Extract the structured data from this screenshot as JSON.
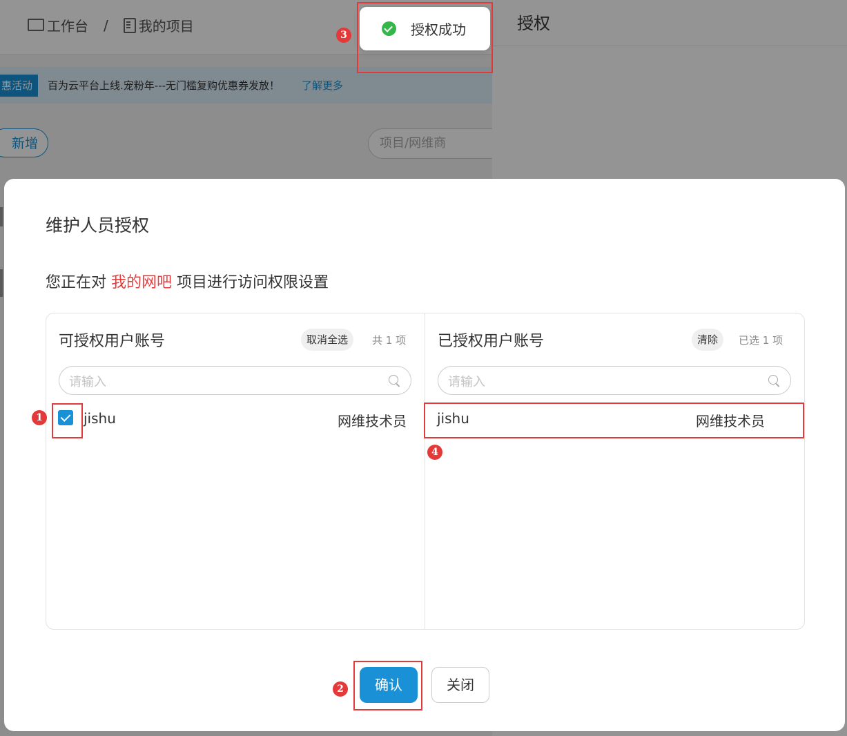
{
  "background": {
    "breadcrumb": {
      "workbench": "工作台",
      "separator": "/",
      "my_projects": "我的项目"
    },
    "notice": {
      "tag": "惠活动",
      "text": "百为云平台上线.宠粉年---无门槛复购优惠券发放！",
      "link": "了解更多"
    },
    "new_button": "新增",
    "search_placeholder": "项目/网维商",
    "drawer_title": "授权"
  },
  "toast": {
    "text": "授权成功",
    "icon": "check-circle-icon",
    "color": "#35b64a"
  },
  "dialog": {
    "title": "维护人员授权",
    "subtitle_prefix": "您正在对",
    "project_name": "我的网吧",
    "subtitle_suffix": "项目进行访问权限设置",
    "left_panel": {
      "title": "可授权用户账号",
      "action": "取消全选",
      "count": "共 1 项",
      "search_placeholder": "请输入",
      "items": [
        {
          "name": "jishu",
          "role": "网维技术员",
          "checked": true
        }
      ]
    },
    "right_panel": {
      "title": "已授权用户账号",
      "action": "清除",
      "count": "已选 1 项",
      "search_placeholder": "请输入",
      "items": [
        {
          "name": "jishu",
          "role": "网维技术员"
        }
      ]
    },
    "confirm_button": "确认",
    "close_button": "关闭"
  },
  "annotations": {
    "step1": "1",
    "step2": "2",
    "step3": "3",
    "step4": "4"
  },
  "colors": {
    "accent": "#1a91d6",
    "highlight": "#e83c3c",
    "annotation": "#e53838"
  }
}
